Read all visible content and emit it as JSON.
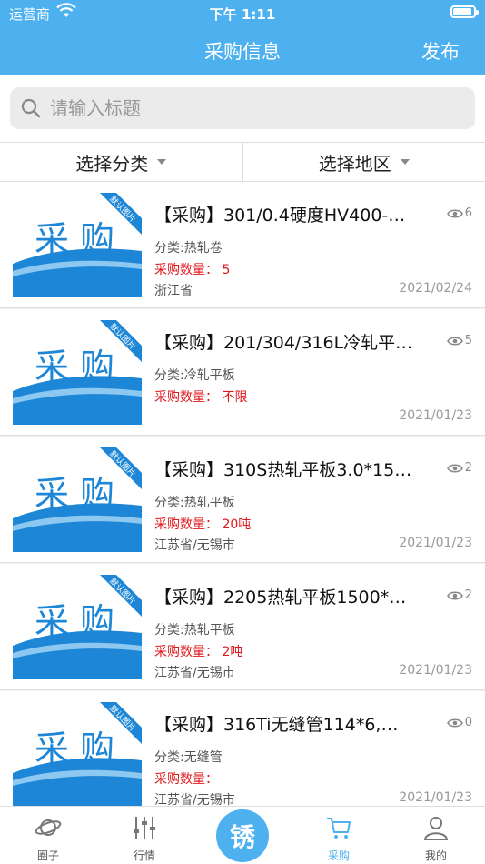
{
  "status": {
    "carrier": "运营商",
    "time": "下午 1:11"
  },
  "nav": {
    "title": "采购信息",
    "publish": "发布"
  },
  "search": {
    "placeholder": "请输入标题"
  },
  "filters": {
    "category": "选择分类",
    "region": "选择地区"
  },
  "thumbnail": {
    "text": "采 购",
    "ribbon": "默认图片"
  },
  "items": [
    {
      "title": "【采购】301/0.4硬度HV400-…",
      "views": "6",
      "category": "分类:热轧卷",
      "quantity": "采购数量： 5",
      "region": "浙江省",
      "date": "2021/02/24"
    },
    {
      "title": "【采购】201/304/316L冷轧平…",
      "views": "5",
      "category": "分类:冷轧平板",
      "quantity": "采购数量： 不限",
      "region": "",
      "date": "2021/01/23"
    },
    {
      "title": "【采购】310S热轧平板3.0*15…",
      "views": "2",
      "category": "分类:热轧平板",
      "quantity": "采购数量： 20吨",
      "region": "江苏省/无锡市",
      "date": "2021/01/23"
    },
    {
      "title": "【采购】2205热轧平板1500*…",
      "views": "2",
      "category": "分类:热轧平板",
      "quantity": "采购数量： 2吨",
      "region": "江苏省/无锡市",
      "date": "2021/01/23"
    },
    {
      "title": "【采购】316Ti无缝管114*6,…",
      "views": "0",
      "category": "分类:无缝管",
      "quantity": "采购数量：",
      "region": "江苏省/无锡市",
      "date": "2021/01/23"
    }
  ],
  "tabs": [
    {
      "label": "圈子",
      "icon": "planet-icon"
    },
    {
      "label": "行情",
      "icon": "sliders-icon"
    },
    {
      "label": "锈",
      "icon": "center-logo"
    },
    {
      "label": "采购",
      "icon": "cart-icon"
    },
    {
      "label": "我的",
      "icon": "person-icon"
    }
  ],
  "colors": {
    "primary": "#4db0ef",
    "alert": "#e0171d"
  }
}
